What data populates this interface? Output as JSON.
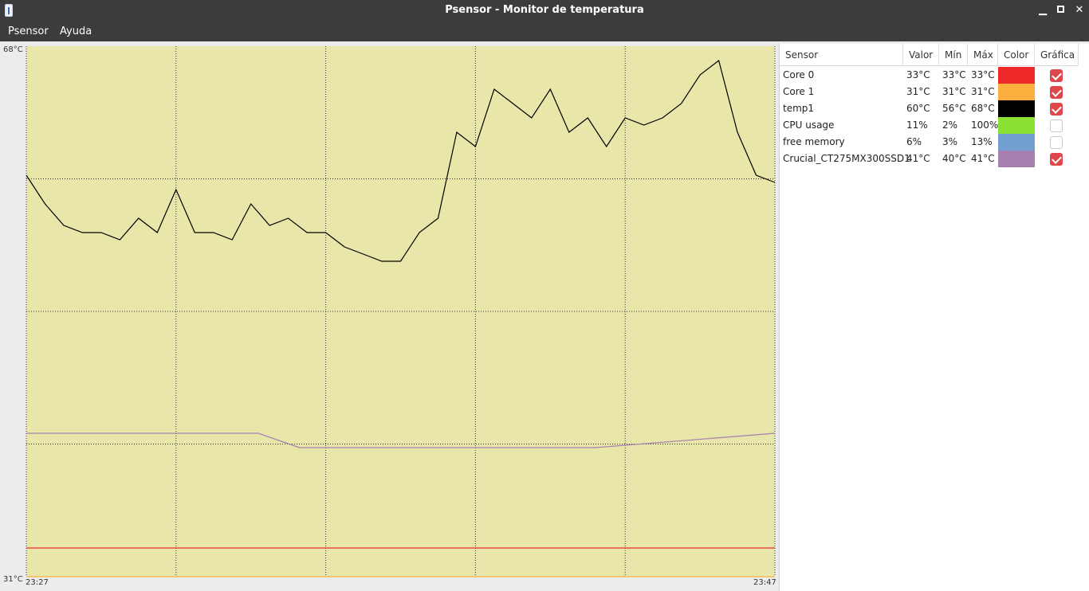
{
  "window": {
    "title": "Psensor - Monitor de temperatura",
    "controls": {
      "minimize": "▁",
      "close": "✕"
    }
  },
  "menu": {
    "items": [
      "Psensor",
      "Ayuda"
    ]
  },
  "graph": {
    "y_max_label": "68°C",
    "y_min_label": "31°C",
    "x_start_label": "23:27",
    "x_end_label": "23:47",
    "background": "#e8e6a9",
    "grid": true
  },
  "chart_data": {
    "type": "line",
    "title": "",
    "xlabel": "",
    "ylabel": "",
    "x_range": [
      "23:27",
      "23:47"
    ],
    "ylim": [
      31,
      68
    ],
    "series": [
      {
        "name": "temp1",
        "color": "#000000",
        "x": [
          0,
          0.5,
          1,
          1.5,
          2,
          2.5,
          3,
          3.5,
          4,
          4.5,
          5,
          5.5,
          6,
          6.5,
          7,
          7.5,
          8,
          8.5,
          9,
          9.5,
          10,
          10.5,
          11,
          11.5,
          12,
          12.5,
          13,
          13.5,
          14,
          14.5,
          15,
          15.5,
          16,
          16.5,
          17,
          17.5,
          18,
          18.5,
          19,
          19.5,
          20
        ],
        "values": [
          59,
          57,
          55.5,
          55,
          55,
          54.5,
          56,
          55,
          58,
          55,
          55,
          54.5,
          57,
          55.5,
          56,
          55,
          55,
          54,
          53.5,
          53,
          53,
          55,
          56,
          62,
          61,
          65,
          64,
          63,
          65,
          62,
          63,
          61,
          63,
          62.5,
          63,
          64,
          66,
          67,
          62,
          59,
          58.5
        ]
      },
      {
        "name": "Crucial_CT275MX300SSD1",
        "color": "#a77fb0",
        "x": [
          0,
          6.2,
          7.3,
          15.2,
          20
        ],
        "values": [
          41,
          41,
          40,
          40,
          41
        ]
      },
      {
        "name": "Core 0",
        "color": "#ef2929",
        "x": [
          0,
          20
        ],
        "values": [
          33,
          33
        ]
      },
      {
        "name": "Core 1",
        "color": "#fcaf3e",
        "x": [
          0,
          20
        ],
        "values": [
          31,
          31
        ]
      }
    ]
  },
  "table": {
    "columns": [
      "Sensor",
      "Valor",
      "Mín",
      "Máx",
      "Color",
      "Gráfica"
    ],
    "rows": [
      {
        "sensor": "Core 0",
        "valor": "33°C",
        "min": "33°C",
        "max": "33°C",
        "color": "#ef2929",
        "graph": true
      },
      {
        "sensor": "Core 1",
        "valor": "31°C",
        "min": "31°C",
        "max": "31°C",
        "color": "#fcaf3e",
        "graph": true
      },
      {
        "sensor": "temp1",
        "valor": "60°C",
        "min": "56°C",
        "max": "68°C",
        "color": "#000000",
        "graph": true
      },
      {
        "sensor": "CPU usage",
        "valor": "11%",
        "min": "2%",
        "max": "100%",
        "color": "#8ae234",
        "graph": false
      },
      {
        "sensor": "free memory",
        "valor": "6%",
        "min": "3%",
        "max": "13%",
        "color": "#729fcf",
        "graph": false
      },
      {
        "sensor": "Crucial_CT275MX300SSD1",
        "valor": "41°C",
        "min": "40°C",
        "max": "41°C",
        "color": "#a77fb0",
        "graph": true
      }
    ]
  }
}
